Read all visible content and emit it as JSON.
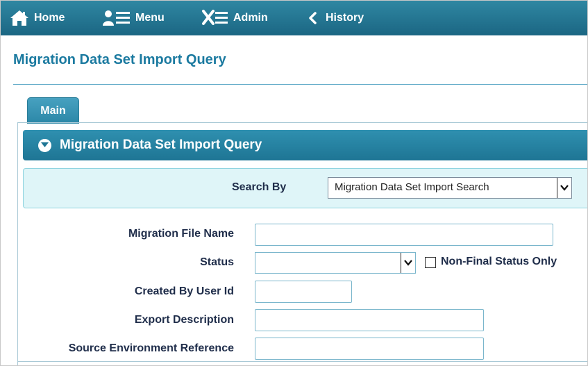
{
  "nav": {
    "home_label": "Home",
    "menu_label": "Menu",
    "admin_label": "Admin",
    "history_label": "History",
    "icons": {
      "home": "home-icon",
      "menu": "user-menu-icon",
      "admin": "tools-icon",
      "history": "chevron-left-icon"
    }
  },
  "page": {
    "title": "Migration Data Set Import Query"
  },
  "tabs": [
    {
      "label": "Main",
      "active": true
    }
  ],
  "section": {
    "title": "Migration Data Set Import Query",
    "collapse_icon": "collapse-circle-icon"
  },
  "search": {
    "search_by_label": "Search By",
    "search_by_value": "Migration Data Set Import Search"
  },
  "fields": {
    "migration_file_name": {
      "label": "Migration File Name",
      "value": ""
    },
    "status": {
      "label": "Status",
      "value": ""
    },
    "non_final_status_only": {
      "label": "Non-Final Status Only",
      "checked": false
    },
    "created_by_user_id": {
      "label": "Created By User Id",
      "value": ""
    },
    "export_description": {
      "label": "Export Description",
      "value": ""
    },
    "source_environment_reference": {
      "label": "Source Environment Reference",
      "value": ""
    }
  },
  "colors": {
    "nav_bg": "#1b6683",
    "title": "#1b7aa0",
    "section_bg": "#1e7594",
    "search_row_bg": "#dff5f8",
    "label_text": "#1f2d4a"
  }
}
